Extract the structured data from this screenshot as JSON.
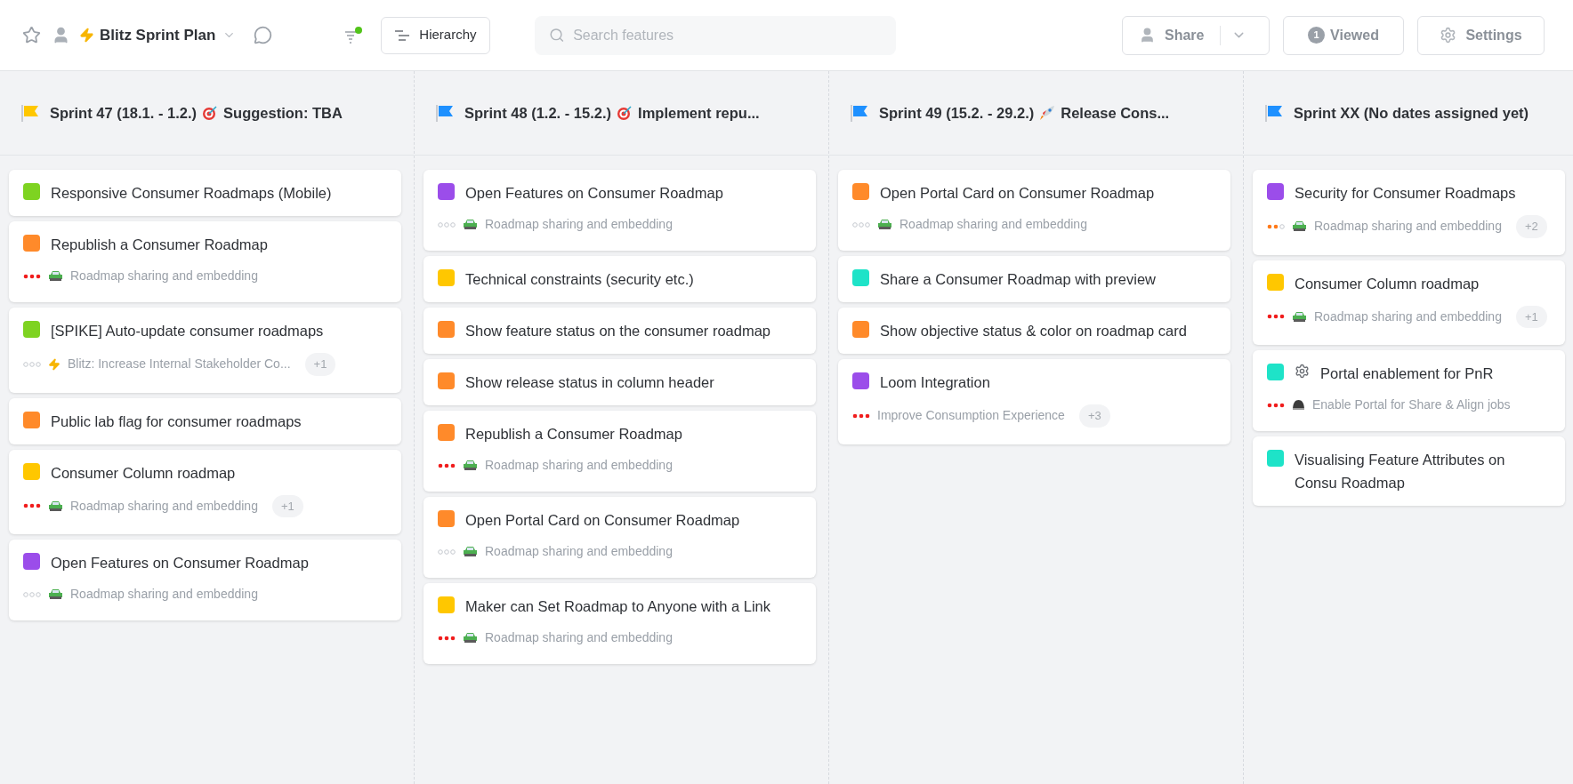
{
  "toolbar": {
    "favorite": false,
    "title": "Blitz Sprint Plan",
    "filter_active": true,
    "hierarchy_button": "Hierarchy",
    "search": {
      "placeholder": "Search features"
    },
    "share_button": "Share",
    "viewed_count": "1",
    "viewed_button": "Viewed",
    "settings_button": "Settings"
  },
  "columns": [
    {
      "color": "#ffc700",
      "title": "Sprint 47 (18.1. - 1.2.)",
      "goal": {
        "kind": "target",
        "label": "Suggestion: TBA"
      },
      "cards": [
        {
          "color": "#7ed321",
          "title": "Responsive Consumer Roadmaps (Mobile)"
        },
        {
          "color": "#ff8a2a",
          "title": "Republish a Consumer Roadmap",
          "priority": {
            "kind": "high"
          },
          "objective": {
            "kind": "car",
            "label": "Roadmap sharing and embedding"
          }
        },
        {
          "color": "#7ed321",
          "title": "[SPIKE] Auto-update consumer roadmaps",
          "priority": {
            "kind": "none"
          },
          "objective": {
            "kind": "bolt",
            "label": "Blitz: Increase Internal Stakeholder Co..."
          },
          "extra": "+1"
        },
        {
          "color": "#ff8a2a",
          "title": "Public lab flag for consumer roadmaps"
        },
        {
          "color": "#ffc700",
          "title": "Consumer Column roadmap",
          "priority": {
            "kind": "high"
          },
          "objective": {
            "kind": "car",
            "label": "Roadmap sharing and embedding"
          },
          "extra": "+1"
        },
        {
          "color": "#9b4dea",
          "title": "Open Features on Consumer Roadmap",
          "priority": {
            "kind": "none"
          },
          "objective": {
            "kind": "car",
            "label": "Roadmap sharing and embedding"
          }
        }
      ]
    },
    {
      "color": "#1e90ff",
      "title": "Sprint 48 (1.2. - 15.2.)",
      "goal": {
        "kind": "target",
        "label": "Implement repu..."
      },
      "cards": [
        {
          "color": "#9b4dea",
          "title": "Open Features on Consumer Roadmap",
          "priority": {
            "kind": "none"
          },
          "objective": {
            "kind": "car",
            "label": "Roadmap sharing and embedding"
          }
        },
        {
          "color": "#ffc700",
          "title": "Technical constraints (security etc.)"
        },
        {
          "color": "#ff8a2a",
          "title": "Show feature status on the consumer roadmap"
        },
        {
          "color": "#ff8a2a",
          "title": "Show release status in column header"
        },
        {
          "color": "#ff8a2a",
          "title": "Republish a Consumer Roadmap",
          "priority": {
            "kind": "high"
          },
          "objective": {
            "kind": "car",
            "label": "Roadmap sharing and embedding"
          }
        },
        {
          "color": "#ff8a2a",
          "title": "Open Portal Card on Consumer Roadmap",
          "priority": {
            "kind": "none"
          },
          "objective": {
            "kind": "car",
            "label": "Roadmap sharing and embedding"
          }
        },
        {
          "color": "#ffc700",
          "title": "Maker can Set Roadmap to Anyone with a Link",
          "priority": {
            "kind": "high"
          },
          "objective": {
            "kind": "car",
            "label": "Roadmap sharing and embedding"
          }
        }
      ]
    },
    {
      "color": "#1e90ff",
      "title": "Sprint 49 (15.2. - 29.2.)",
      "goal": {
        "kind": "rocket",
        "label": "Release Cons..."
      },
      "cards": [
        {
          "color": "#ff8a2a",
          "title": "Open Portal Card on Consumer Roadmap",
          "priority": {
            "kind": "none"
          },
          "objective": {
            "kind": "car",
            "label": "Roadmap sharing and embedding"
          }
        },
        {
          "color": "#1ee3c8",
          "title": "Share a Consumer Roadmap with preview"
        },
        {
          "color": "#ff8a2a",
          "title": "Show objective status & color on roadmap card"
        },
        {
          "color": "#9b4dea",
          "title": "Loom Integration",
          "priority": {
            "kind": "high"
          },
          "objective": {
            "kind": "plain",
            "label": "Improve Consumption Experience"
          },
          "extra": "+3"
        }
      ]
    },
    {
      "color": "#1e90ff",
      "title": "Sprint XX (No dates assigned yet)",
      "cards": [
        {
          "color": "#9b4dea",
          "title": "Security for Consumer Roadmaps",
          "priority": {
            "kind": "medium"
          },
          "objective": {
            "kind": "car",
            "label": "Roadmap sharing and embedding"
          },
          "extra": "+2"
        },
        {
          "color": "#ffc700",
          "title": "Consumer Column roadmap",
          "priority": {
            "kind": "high"
          },
          "objective": {
            "kind": "car",
            "label": "Roadmap sharing and embedding"
          },
          "extra": "+1"
        },
        {
          "color": "#1ee3c8",
          "kind": "gear",
          "title": "Portal enablement for PnR",
          "priority": {
            "kind": "high"
          },
          "objective": {
            "kind": "helmet",
            "label": "Enable Portal for Share & Align jobs"
          }
        },
        {
          "color": "#1ee3c8",
          "title": "Visualising Feature Attributes on Consu Roadmap"
        }
      ]
    }
  ]
}
